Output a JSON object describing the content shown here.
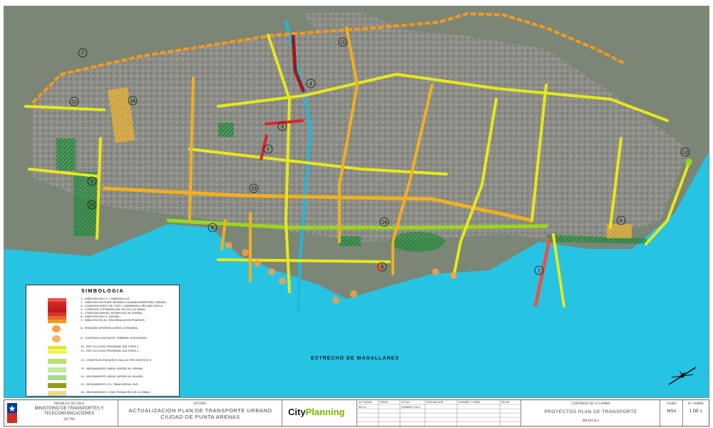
{
  "map": {
    "strait_label": "ESTRECHO DE MAGALLANES",
    "colors": {
      "sea": "#27c3e3",
      "land": "#7f8a7b",
      "urban": "#8c8c86",
      "river": "#22b8d8",
      "red": "#d8242a",
      "dark_red": "#a01818",
      "orange": "#f39a1a",
      "yellow": "#e8e81a",
      "green_hatch": "#1a9a3a",
      "lime": "#9ad81a"
    },
    "project_numbers": [
      "1",
      "2",
      "3",
      "4",
      "5",
      "6",
      "7",
      "8",
      "9",
      "10",
      "11",
      "12",
      "13",
      "14",
      "15",
      "16"
    ]
  },
  "legend": {
    "title": "SIMBOLOGIA",
    "items": [
      {
        "label": "1.- HABILITACION E.E. CHARAMOLILLO.",
        "color": "#e8534a"
      },
      {
        "label": "2.- HABILITACION PEDRO BERNUEZ SALBENA-MINISTERIO TARNAVI.",
        "color": "#d8242a"
      },
      {
        "label": "3.- CONEXION MATEO DE TORO Y ZAMBRANO-CIRILIANO VISELA.",
        "color": "#c81e22"
      },
      {
        "label": "4.- CONEXION COSTANERA DEL RIO DE LAS MINAS.",
        "color": "#b81a1e"
      },
      {
        "label": "5.- CONEXION MANUEL RODRIGUEZ-AV. ESPAÑA.",
        "color": "#d8342a"
      },
      {
        "label": "6.- HABILITACION E.E. BULNES.",
        "color": "#e86a30"
      },
      {
        "label": "7.- HABILITACION AV. CIRCUNVALACION PONIENTE.",
        "color": "#f39a1a"
      },
      {
        "label": "8.- REDISEÑO INTERSECCIONES COSTANERA.",
        "color": "#f5a04a"
      },
      {
        "label": "9.- CONSTRUCCION NUEVO TERMINAL RODOVIARIO.",
        "color": "#f5b560"
      },
      {
        "label": "10.- RED CICLOVIAS PRIORIDAD 2DA ETAPA 1.",
        "color": "#e8e81a"
      },
      {
        "label": "11.- RED CICLOVIAS PRIORIDAD 2DA ETAPA 2.",
        "color": "#f0f060"
      },
      {
        "label": "12.- CONSTRUCCION NUEVO VIAL AV. FREI DEN RUTA 9.",
        "color": "#b8e070"
      },
      {
        "label": "13.- MEJORAMIENTO AREAS VERDES AV. ESPAÑA.",
        "color": "#c0e8a0"
      },
      {
        "label": "14.- MEJORAMIENTO AREAS VERDES AV. BULNES.",
        "color": "#a8d890"
      },
      {
        "label": "15.- MEJORAMIENTO E.E. TRANSVERSAL SUR.",
        "color": "#9a9a1a"
      },
      {
        "label": "16.- MEJORAMIENTO CONECTIVIDAD RIO DE LA MINAS.",
        "color": "#f0d890"
      }
    ]
  },
  "title_block": {
    "ministry_line1": "REPUBLICA DE CHILE",
    "ministry_line2": "MINISTERIO DE TRANSPORTES Y",
    "ministry_line3": "TELECOMUNICACIONES",
    "ministry_line4": "SECTRA",
    "study_label": "ESTUDIO:",
    "study_line1": "ACTUALIZACION PLAN DE TRANSPORTE URBANO",
    "study_line2": "CIUDAD DE PUNTA ARENAS",
    "logo_city": "City",
    "logo_planning": "Planning",
    "grid_headers": [
      "ACTIVIDAD",
      "FIRMA",
      "FECHA",
      "APROBACION",
      "NOMBRE Y FIRMA",
      "FECHA"
    ],
    "grid_values": [
      "REV A",
      "",
      "FEBRERO 2021",
      "",
      "",
      ""
    ],
    "content_label": "CONTENIDO DE LA LAMINA",
    "content_title": "PROYECTOS PLAN DE TRANSPORTE",
    "scale": "SIN ESCALA",
    "plano_label": "PLANO",
    "plano_value": "MSA",
    "lamina_label": "N° LAMINA",
    "lamina_value": "1 DE 1"
  }
}
